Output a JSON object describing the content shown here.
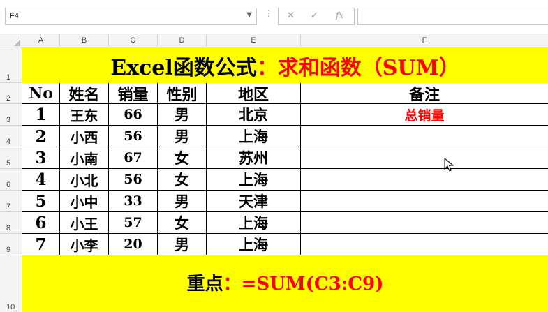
{
  "name_box": {
    "value": "F4"
  },
  "formula_bar": {
    "cancel_icon": "✕",
    "enter_icon": "✓",
    "fx_label": "fx",
    "value": ""
  },
  "columns": [
    "A",
    "B",
    "C",
    "D",
    "E",
    "F"
  ],
  "rows": [
    "1",
    "2",
    "3",
    "4",
    "5",
    "6",
    "7",
    "8",
    "9",
    "10"
  ],
  "title": {
    "black_part": "Excel函数公式",
    "red_part": "：求和函数（SUM）"
  },
  "table": {
    "headers": [
      "No",
      "姓名",
      "销量",
      "性别",
      "地区",
      "备注"
    ],
    "rows": [
      [
        "1",
        "王东",
        "66",
        "男",
        "北京",
        "总销量"
      ],
      [
        "2",
        "小西",
        "56",
        "男",
        "上海",
        ""
      ],
      [
        "3",
        "小南",
        "67",
        "女",
        "苏州",
        ""
      ],
      [
        "4",
        "小北",
        "56",
        "女",
        "上海",
        ""
      ],
      [
        "5",
        "小中",
        "33",
        "男",
        "天津",
        ""
      ],
      [
        "6",
        "小王",
        "57",
        "女",
        "上海",
        ""
      ],
      [
        "7",
        "小李",
        "20",
        "男",
        "上海",
        ""
      ]
    ]
  },
  "footer": {
    "black_part": "重点",
    "red_part": "：=SUM(C3:C9)"
  },
  "colors": {
    "highlight": "#ffff00",
    "accent_red": "#ff0000"
  }
}
